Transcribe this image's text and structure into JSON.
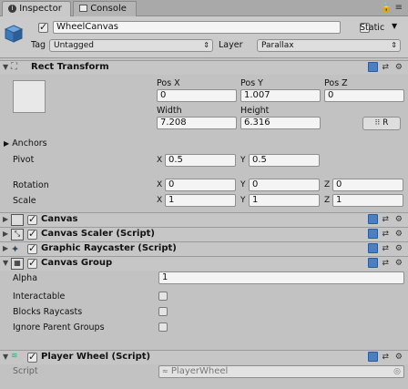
{
  "tabs": [
    {
      "label": "Inspector",
      "icon": "info-icon"
    },
    {
      "label": "Console",
      "icon": "console-icon"
    }
  ],
  "header": {
    "object_name": "WheelCanvas",
    "static_label": "Static",
    "tag_label": "Tag",
    "tag_value": "Untagged",
    "layer_label": "Layer",
    "layer_value": "Parallax"
  },
  "rect_transform": {
    "title": "Rect Transform",
    "pos_x_label": "Pos X",
    "pos_y_label": "Pos Y",
    "pos_z_label": "Pos Z",
    "pos_x": "0",
    "pos_y": "1.007",
    "pos_z": "0",
    "width_label": "Width",
    "height_label": "Height",
    "width": "7.208",
    "height": "6.316",
    "r_button": "R",
    "anchors_label": "Anchors",
    "pivot_label": "Pivot",
    "pivot_x": "0.5",
    "pivot_y": "0.5",
    "rotation_label": "Rotation",
    "rot_x": "0",
    "rot_y": "0",
    "rot_z": "0",
    "scale_label": "Scale",
    "scale_x": "1",
    "scale_y": "1",
    "scale_z": "1",
    "x": "X",
    "y": "Y",
    "z": "Z"
  },
  "components": {
    "canvas": "Canvas",
    "canvas_scaler": "Canvas Scaler (Script)",
    "graphic_raycaster": "Graphic Raycaster (Script)",
    "canvas_group": "Canvas Group"
  },
  "canvas_group": {
    "alpha_label": "Alpha",
    "alpha": "1",
    "interactable_label": "Interactable",
    "blocks_raycasts_label": "Blocks Raycasts",
    "ignore_parent_label": "Ignore Parent Groups"
  },
  "player_wheel": {
    "title": "Player Wheel (Script)",
    "script_label": "Script",
    "script_value": "PlayerWheel"
  },
  "colors": {
    "accent": "#4a7fc1",
    "panel": "#c2c2c2",
    "field": "#f4f4f4"
  }
}
